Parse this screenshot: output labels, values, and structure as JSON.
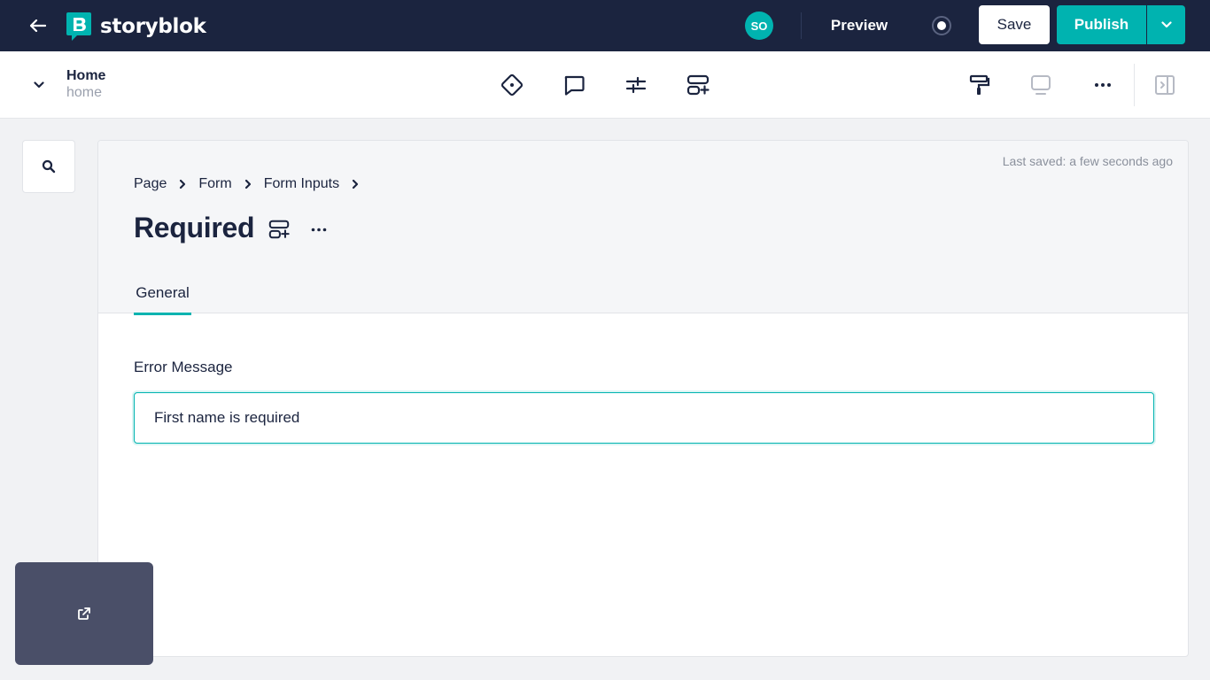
{
  "topbar": {
    "logo_text": "storyblok",
    "avatar_initials": "SO",
    "preview_label": "Preview",
    "save_label": "Save",
    "publish_label": "Publish",
    "colors": {
      "bar": "#1b243f",
      "accent": "#00b3b0"
    }
  },
  "story": {
    "name": "Home",
    "slug": "home"
  },
  "panel": {
    "last_saved": "Last saved: a few seconds ago",
    "breadcrumb": [
      "Page",
      "Form",
      "Form Inputs"
    ],
    "title": "Required",
    "tabs": [
      {
        "label": "General",
        "active": true
      }
    ],
    "field": {
      "label": "Error Message",
      "value": "First name is required"
    }
  },
  "icons": {
    "back": "arrow-left-icon",
    "record": "record-icon",
    "dropdown": "chevron-down-icon",
    "toolbar": [
      "diamond-icon",
      "comment-icon",
      "sliders-icon",
      "add-block-icon",
      "paint-roller-icon",
      "monitor-icon",
      "more-horizontal-icon",
      "panel-toggle-icon"
    ],
    "search": "search-icon",
    "external": "external-link-icon"
  }
}
